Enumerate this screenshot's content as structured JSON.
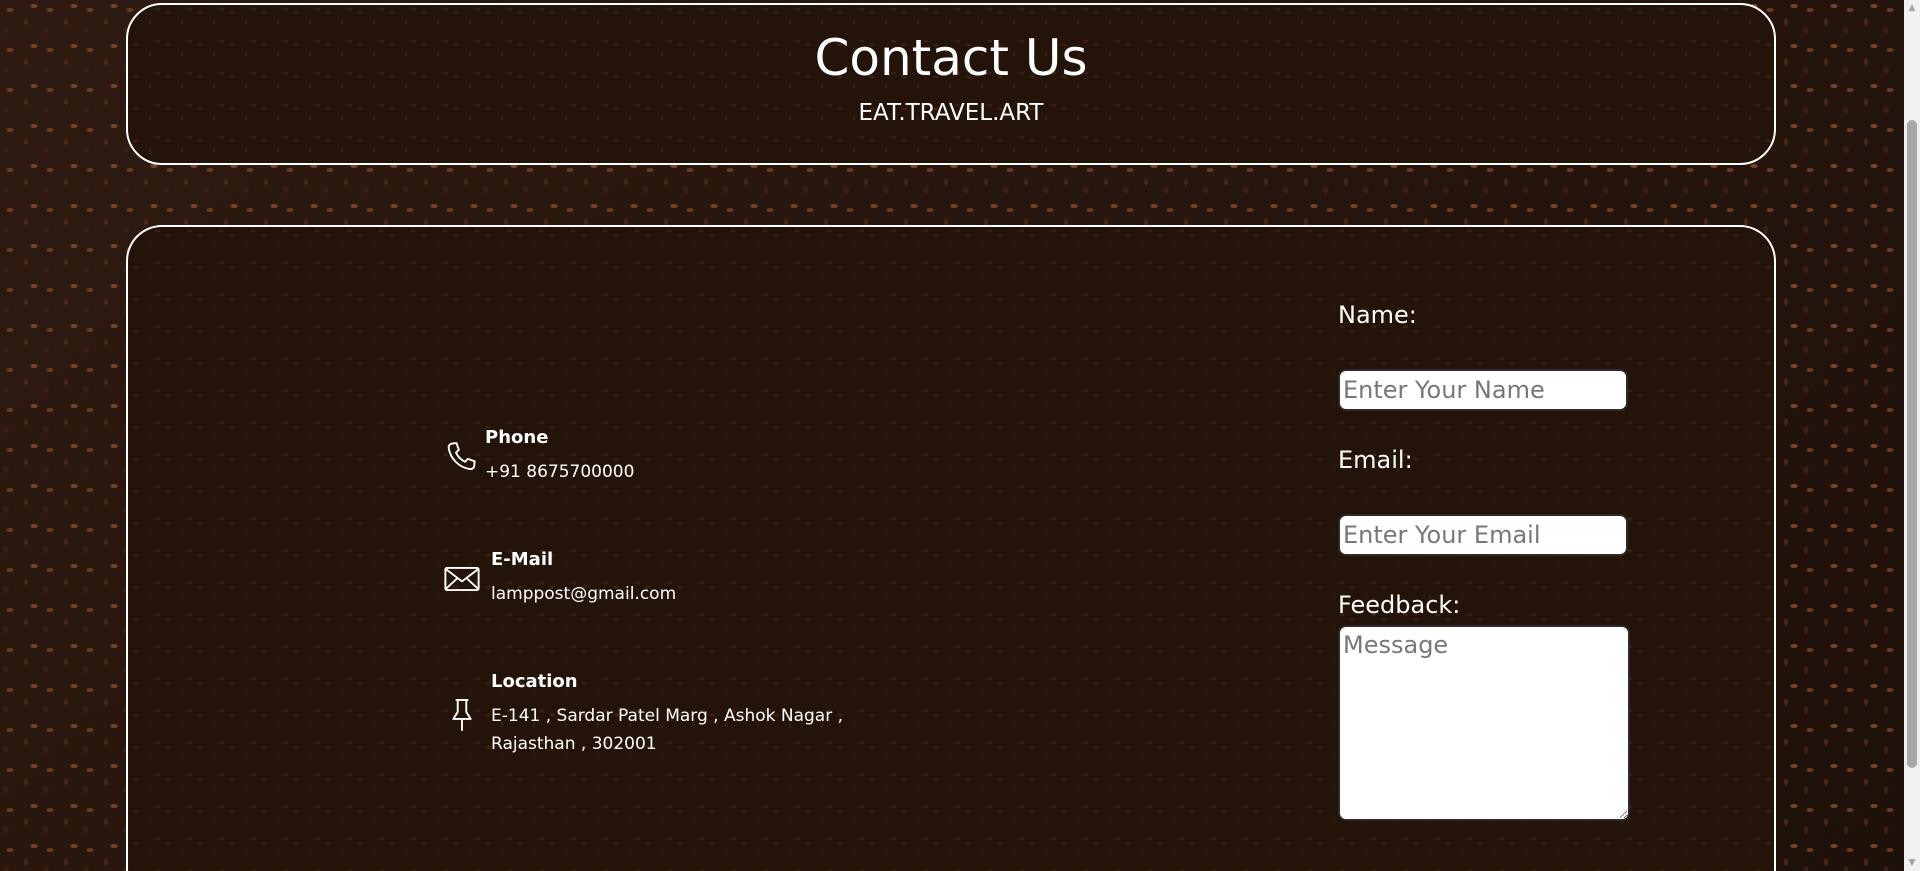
{
  "header": {
    "title": "Contact Us",
    "subtitle": "EAT.TRAVEL.ART"
  },
  "contact": {
    "phone": {
      "title": "Phone",
      "value": "+91 8675700000",
      "icon": "phone-icon"
    },
    "email": {
      "title": "E-Mail",
      "value": "lamppost@gmail.com",
      "icon": "envelope-icon"
    },
    "location": {
      "title": "Location",
      "value": "E-141 , Sardar Patel Marg , Ashok Nagar , Rajasthan , 302001",
      "icon": "pushpin-icon"
    }
  },
  "form": {
    "name_label": "Name:",
    "name_placeholder": "Enter Your Name",
    "email_label": "Email:",
    "email_placeholder": "Enter Your Email",
    "feedback_label": "Feedback:",
    "feedback_placeholder": "Message"
  },
  "colors": {
    "text": "#ffffff",
    "panel_border": "#ffffff",
    "background": "#2a1810"
  }
}
